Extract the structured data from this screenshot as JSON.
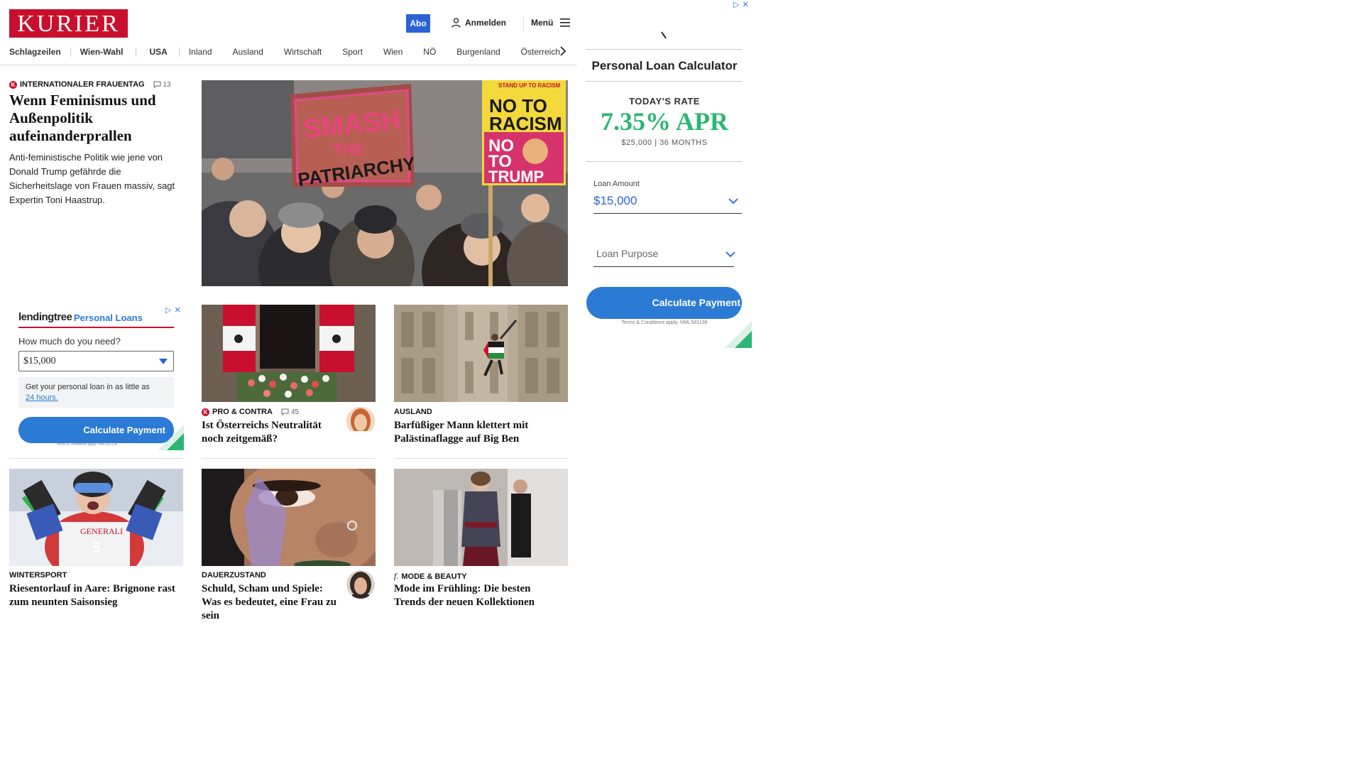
{
  "header": {
    "logo": "KURIER",
    "abo_label": "Abo",
    "login_label": "Anmelden",
    "menu_label": "Menü"
  },
  "nav": {
    "items": [
      "Schlagzeilen",
      "Wien-Wahl",
      "USA",
      "Inland",
      "Ausland",
      "Wirtschaft",
      "Sport",
      "Wien",
      "NÖ",
      "Burgenland",
      "Österreich"
    ]
  },
  "lead": {
    "kicker": "INTERNATIONALER FRAUENTAG",
    "comments": "13",
    "headline": "Wenn Feminismus und Außenpolitik aufeinanderprallen",
    "teaser": "Anti-feministische Politik wie jene von Donald Trump gefährde die Sicherheitslage von Frauen massiv, sagt Expertin Toni Haastrup.",
    "sign_left": "SMASH THE PATRIARCHY",
    "sign_right_top": "STAND UP TO RACISM",
    "sign_right_1": "NO TO RACISM",
    "sign_right_2": "NO TO TRUMP"
  },
  "articles": [
    {
      "kicker": "PRO & CONTRA",
      "comments": "45",
      "headline": "Ist Österreichs Neutralität noch zeitgemäß?",
      "badge": "K"
    },
    {
      "kicker": "AUSLAND",
      "headline": "Barfüßiger Mann klettert mit Palästinaflagge auf Big Ben"
    },
    {
      "kicker": "WINTERSPORT",
      "headline": "Riesentorlauf in Aare: Brignone rast zum neunten Saisonsieg",
      "bib": "5",
      "sponsor": "GENERALI"
    },
    {
      "kicker": "DAUERZUSTAND",
      "headline": "Schuld, Scham und Spiele: Was es bedeutet, eine Frau zu sein"
    },
    {
      "kicker": "MODE & BEAUTY",
      "headline": "Mode im Frühling: Die besten Trends der neuen Kollektionen",
      "icon": "f."
    }
  ],
  "ad_left": {
    "brand": "lendingtree",
    "product": "Personal Loans",
    "question": "How much do you need?",
    "amount": "$15,000",
    "info_prefix": "Get your personal loan in as little as",
    "info_link": "24 hours.",
    "cta": "Calculate Payment",
    "terms": "Terms & Conditions apply. NMLS#1136"
  },
  "ad_right": {
    "title": "Personal Loan Calculator",
    "rate_label": "TODAY'S RATE",
    "rate": "7.35% APR",
    "rate_sub": "$25,000 | 36 MONTHS",
    "loan_amount_label": "Loan Amount",
    "loan_amount_value": "$15,000",
    "loan_purpose_placeholder": "Loan Purpose",
    "cta": "Calculate Payment",
    "terms": "Terms & Conditions apply. NMLS#1136"
  },
  "colors": {
    "brand_red": "#c8102e",
    "abo_blue": "#2b63d6",
    "ad_blue": "#2b7bd4",
    "rate_green": "#2bb673"
  },
  "icons": [
    "user-icon",
    "hamburger-icon",
    "chevron-right-icon",
    "comment-icon",
    "chevron-down-icon",
    "adchoices-icon",
    "close-icon"
  ]
}
